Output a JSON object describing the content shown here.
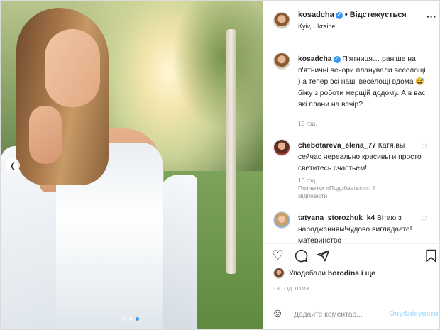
{
  "post": {
    "author": "kosadcha",
    "verified_icon": "verified-badge-icon",
    "follow_status": "Відстежується",
    "separator": "•",
    "location": "Kyiv, Ukraine",
    "more_icon": "more-options-icon"
  },
  "carousel": {
    "dots": 3,
    "active_index": 2,
    "prev_icon": "chevron-left-icon"
  },
  "caption": {
    "user": "kosadcha",
    "text": "П'ятниця… раніше на п'ятничні вечори планували веселощі ) а тепер всі наші веселощі вдома 😅 біжу з роботи мерщій додому. А в вас які плани на вечір?",
    "time": "18 год."
  },
  "comments": [
    {
      "user": "chebotareva_elena_77",
      "text": "Катя,вы сейчас нереально красивы и просто светитесь счастьем!",
      "time": "16 год.",
      "likes": "Позначки «Подобається»: 7",
      "reply": "Відповісти"
    },
    {
      "user": "tatyana_storozhuk_k4",
      "text": "Вітаю з народженням!чудово виглядаєте!материнство"
    }
  ],
  "actions": {
    "like_icon": "heart-icon",
    "comment_icon": "comment-icon",
    "share_icon": "share-icon",
    "save_icon": "bookmark-icon"
  },
  "likes": {
    "prefix": "Уподобали",
    "user": "borodina",
    "suffix": "і ще"
  },
  "timestamp": "18 ГОД ТОМУ",
  "add_comment": {
    "emoji_icon": "emoji-icon",
    "placeholder": "Додайте коментар...",
    "publish": "Опублікувати"
  },
  "colors": {
    "accent": "#3897f0",
    "publish_disabled": "#b2dffc",
    "muted": "#8e8e8e"
  }
}
